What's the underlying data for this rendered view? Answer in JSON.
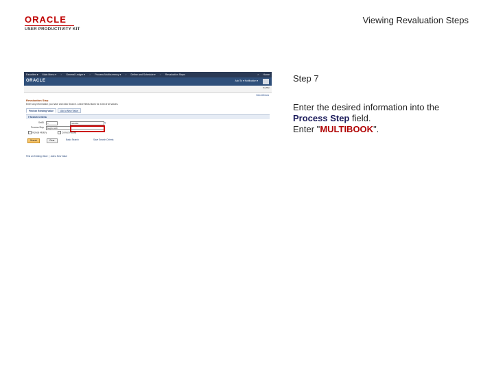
{
  "slide": {
    "logo_brand": "ORACLE",
    "logo_product": "USER PRODUCTIVITY KIT",
    "title": "Viewing Revaluation Steps",
    "step": "Step 7",
    "instruction_pre": "Enter the desired information into the ",
    "instruction_field": "Process Step",
    "instruction_post": " field.",
    "enter_pre": "Enter \"",
    "enter_value": "MULTIBOOK",
    "enter_post": "\"."
  },
  "screen": {
    "menubar": {
      "items": [
        "Favorites ▾",
        "Main Menu ▾",
        ">",
        "General Ledger ▾",
        ">",
        "Process Multicurrency ▾",
        ">",
        "Define and Schedule ▾",
        ">",
        "Revaluation Steps"
      ],
      "home": "Home"
    },
    "brand": "ORACLE",
    "actions": "Add To ▾   Notification ▾",
    "favorites_label": "NavBar",
    "new_window": "New Window",
    "page_title": "Revaluation Step",
    "help_text": "Enter any information you have and click Search. Leave fields blank for a list of all values.",
    "tabs": [
      "Find an Existing Value",
      "Add a New Value"
    ],
    "criteria_header": "Search Criteria",
    "setid_label": "SetID",
    "setid_op": "=",
    "setid_value": "SHARE",
    "process_label": "Process Step",
    "process_op": "begins with",
    "process_value": "",
    "include_history": "Include History",
    "correct_history": "Correct History",
    "search_btn": "Search",
    "clear_btn": "Clear",
    "basic_search": "Basic Search",
    "save_criteria": "Save Search Criteria",
    "find_link": "Find an Existing Value",
    "add_link": "Add a New Value"
  }
}
